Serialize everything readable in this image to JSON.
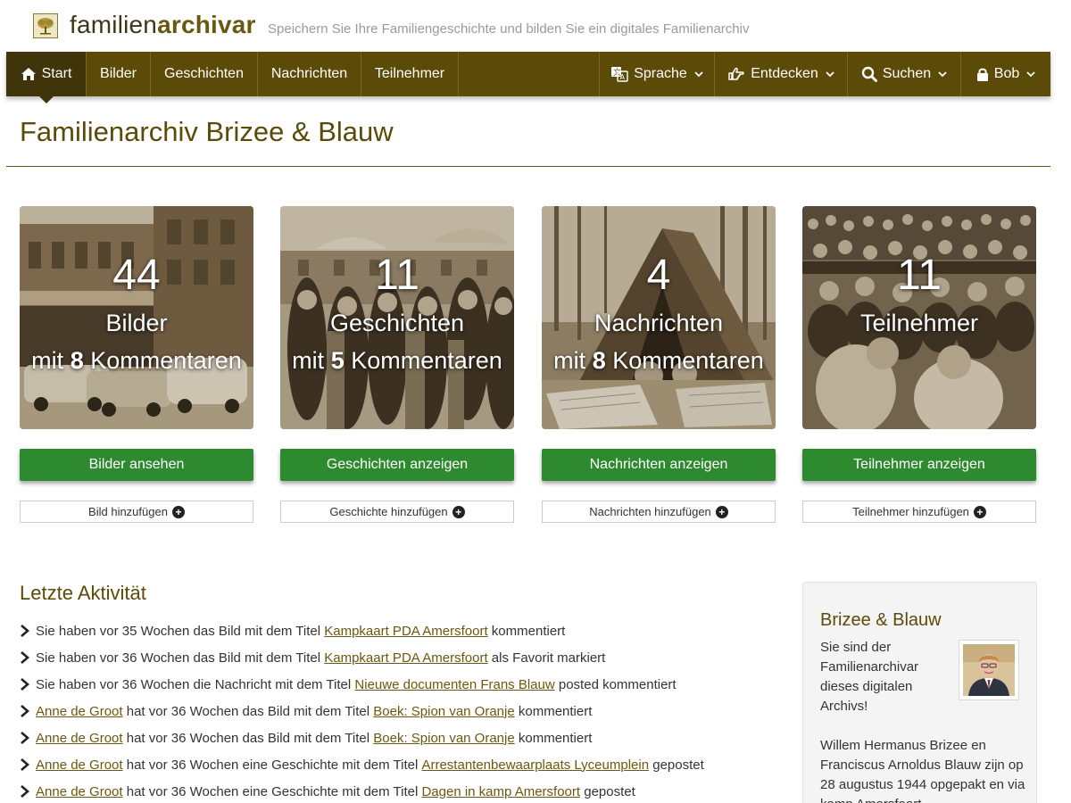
{
  "brand": {
    "logo_light": "familien",
    "logo_bold": "archivar",
    "tagline": "Speichern Sie Ihre Familiengeschichte und bilden Sie ein digitales Familienarchiv",
    "accent_color": "#5c4b08",
    "button_color": "#2e8a2f"
  },
  "nav": {
    "left": [
      {
        "label": "Start",
        "icon": "home-icon",
        "active": true
      },
      {
        "label": "Bilder"
      },
      {
        "label": "Geschichten"
      },
      {
        "label": "Nachrichten"
      },
      {
        "label": "Teilnehmer"
      }
    ],
    "right": [
      {
        "label": "Sprache",
        "icon": "translate-icon"
      },
      {
        "label": "Entdecken",
        "icon": "hand-pointer-icon"
      },
      {
        "label": "Suchen",
        "icon": "search-icon"
      },
      {
        "label": "Bob",
        "icon": "lock-icon"
      }
    ]
  },
  "page": {
    "title": "Familienarchiv Brizee & Blauw"
  },
  "cards": [
    {
      "count": "44",
      "label": "Bilder",
      "comments_prefix": "mit",
      "comments_count": "8",
      "comments_suffix": "Kommentaren",
      "view_button": "Bilder ansehen",
      "add_button": "Bild hinzufügen"
    },
    {
      "count": "11",
      "label": "Geschichten",
      "comments_prefix": "mit",
      "comments_count": "5",
      "comments_suffix": "Kommentaren",
      "view_button": "Geschichten anzeigen",
      "add_button": "Geschichte hinzufügen"
    },
    {
      "count": "4",
      "label": "Nachrichten",
      "comments_prefix": "mit",
      "comments_count": "8",
      "comments_suffix": "Kommentaren",
      "view_button": "Nachrichten anzeigen",
      "add_button": "Nachrichten hinzufügen"
    },
    {
      "count": "11",
      "label": "Teilnehmer",
      "comments_prefix": "",
      "comments_count": "",
      "comments_suffix": "",
      "view_button": "Teilnehmer anzeigen",
      "add_button": "Teilnehmer hinzufügen"
    }
  ],
  "activity": {
    "title": "Letzte Aktivität",
    "items": [
      {
        "actor": "",
        "text1": "Sie haben vor 35 Wochen das Bild mit dem Titel ",
        "link": "Kampkaart PDA Amersfoort",
        "text2": " kommentiert"
      },
      {
        "actor": "",
        "text1": "Sie haben vor 36 Wochen das Bild mit dem Titel ",
        "link": "Kampkaart PDA Amersfoort",
        "text2": " als Favorit markiert"
      },
      {
        "actor": "",
        "text1": "Sie haben vor 36 Wochen die Nachricht mit dem Titel ",
        "link": "Nieuwe documenten Frans Blauw",
        "text2": " posted kommentiert"
      },
      {
        "actor": "Anne de Groot",
        "text1": " hat vor 36 Wochen das Bild mit dem Titel ",
        "link": "Boek: Spion van Oranje",
        "text2": " kommentiert"
      },
      {
        "actor": "Anne de Groot",
        "text1": " hat vor 36 Wochen das Bild mit dem Titel ",
        "link": "Boek: Spion van Oranje",
        "text2": " kommentiert"
      },
      {
        "actor": "Anne de Groot",
        "text1": " hat vor 36 Wochen eine Geschichte mit dem Titel ",
        "link": "Arrestantenbewaarplaats Lyceumplein",
        "text2": " gepostet"
      },
      {
        "actor": "Anne de Groot",
        "text1": " hat vor 36 Wochen eine Geschichte mit dem Titel ",
        "link": "Dagen in kamp Amersfoort",
        "text2": " gepostet"
      }
    ]
  },
  "sidebar": {
    "title": "Brizee & Blauw",
    "text1": "Sie sind der Familienarchivar dieses digitalen Archivs!",
    "text2": "Willem Hermanus Brizee en Franciscus Arnoldus Blauw zijn op 28 augustus 1944 opgepakt en via kamp Amersfoort"
  }
}
